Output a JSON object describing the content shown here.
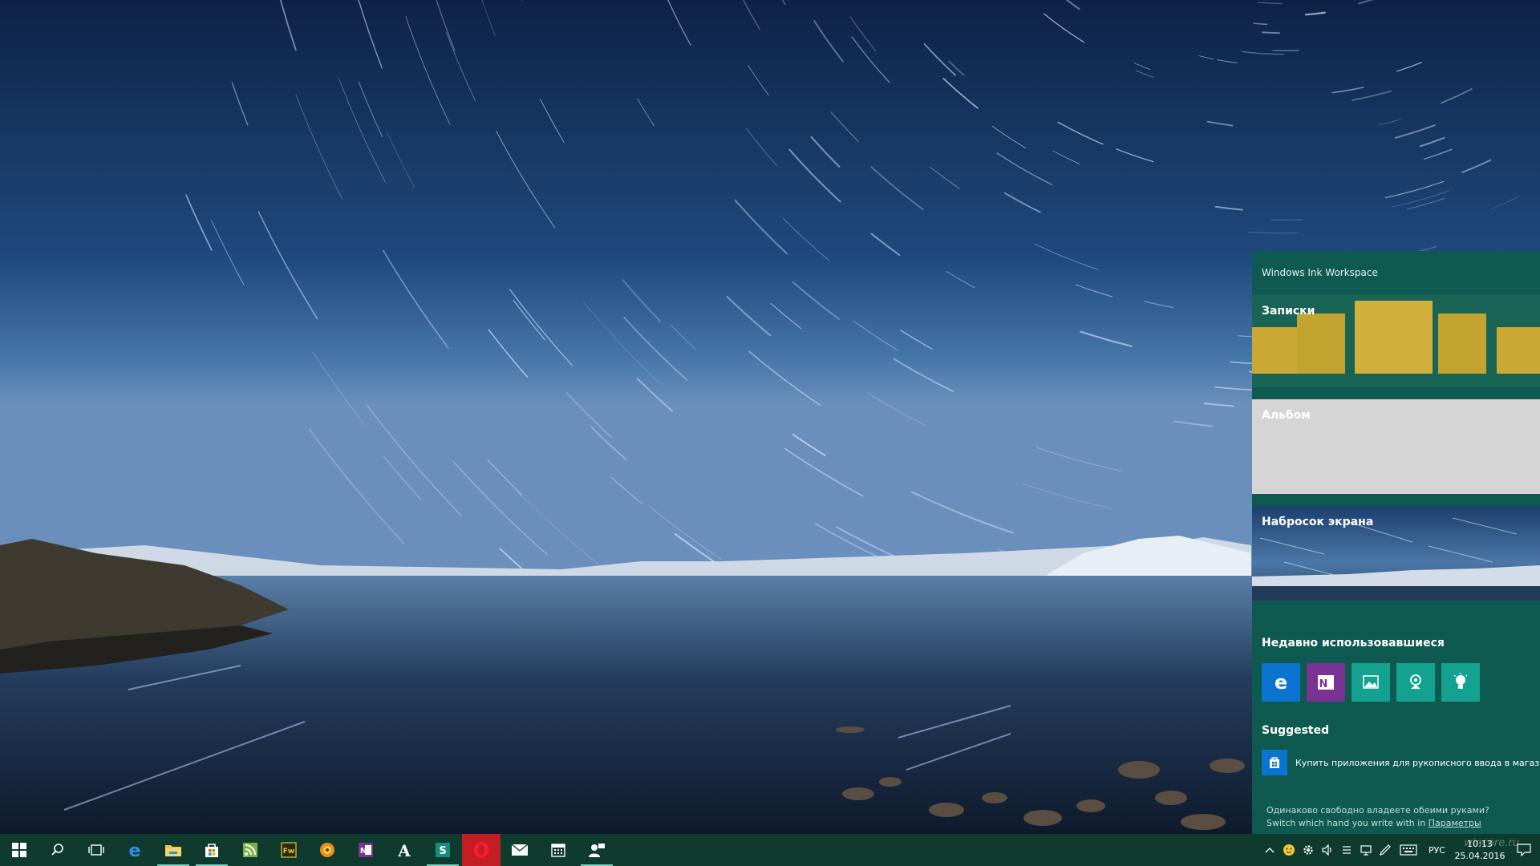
{
  "desktop": {
    "wallpaper": "night sky star trails over a lake"
  },
  "ink_workspace": {
    "title": "Windows Ink Workspace",
    "cards": {
      "notes": "Записки",
      "album": "Альбом",
      "sketch": "Набросок экрана"
    },
    "recent_heading": "Недавно использовавшиеся",
    "recent_apps": [
      {
        "name": "edge-icon",
        "color": "#0a74d0"
      },
      {
        "name": "onenote-icon",
        "color": "#7a3294"
      },
      {
        "name": "photos-icon",
        "color": "#14a18f"
      },
      {
        "name": "maps-icon",
        "color": "#14a18f"
      },
      {
        "name": "tips-icon",
        "color": "#14a18f"
      }
    ],
    "suggested_heading": "Suggested",
    "suggested_item": "Купить приложения для рукописного ввода в магазине",
    "footer_line1": "Одинаково свободно владеете обеими руками?",
    "footer_line2": "Switch which hand you write with in ",
    "footer_link": "Параметры"
  },
  "taskbar": {
    "apps": [
      "start-icon",
      "search-icon",
      "task-view-icon",
      "edge-icon",
      "file-explorer-icon",
      "store-icon",
      "feed-reader-icon",
      "fireworks-icon",
      "media-player-icon",
      "onenote-icon",
      "font-app-icon",
      "sway-icon",
      "opera-icon",
      "mail-icon",
      "calendar-icon",
      "contact-support-icon"
    ],
    "language": "РУС",
    "time": "10:13",
    "date": "25.04.2016",
    "watermark": "wincore.ru"
  },
  "colors": {
    "panel_bg": "#0f5a50",
    "taskbar_bg": "#0f3b2e",
    "sticky_notes": "#c9a934",
    "accent_blue": "#0a74d0"
  }
}
